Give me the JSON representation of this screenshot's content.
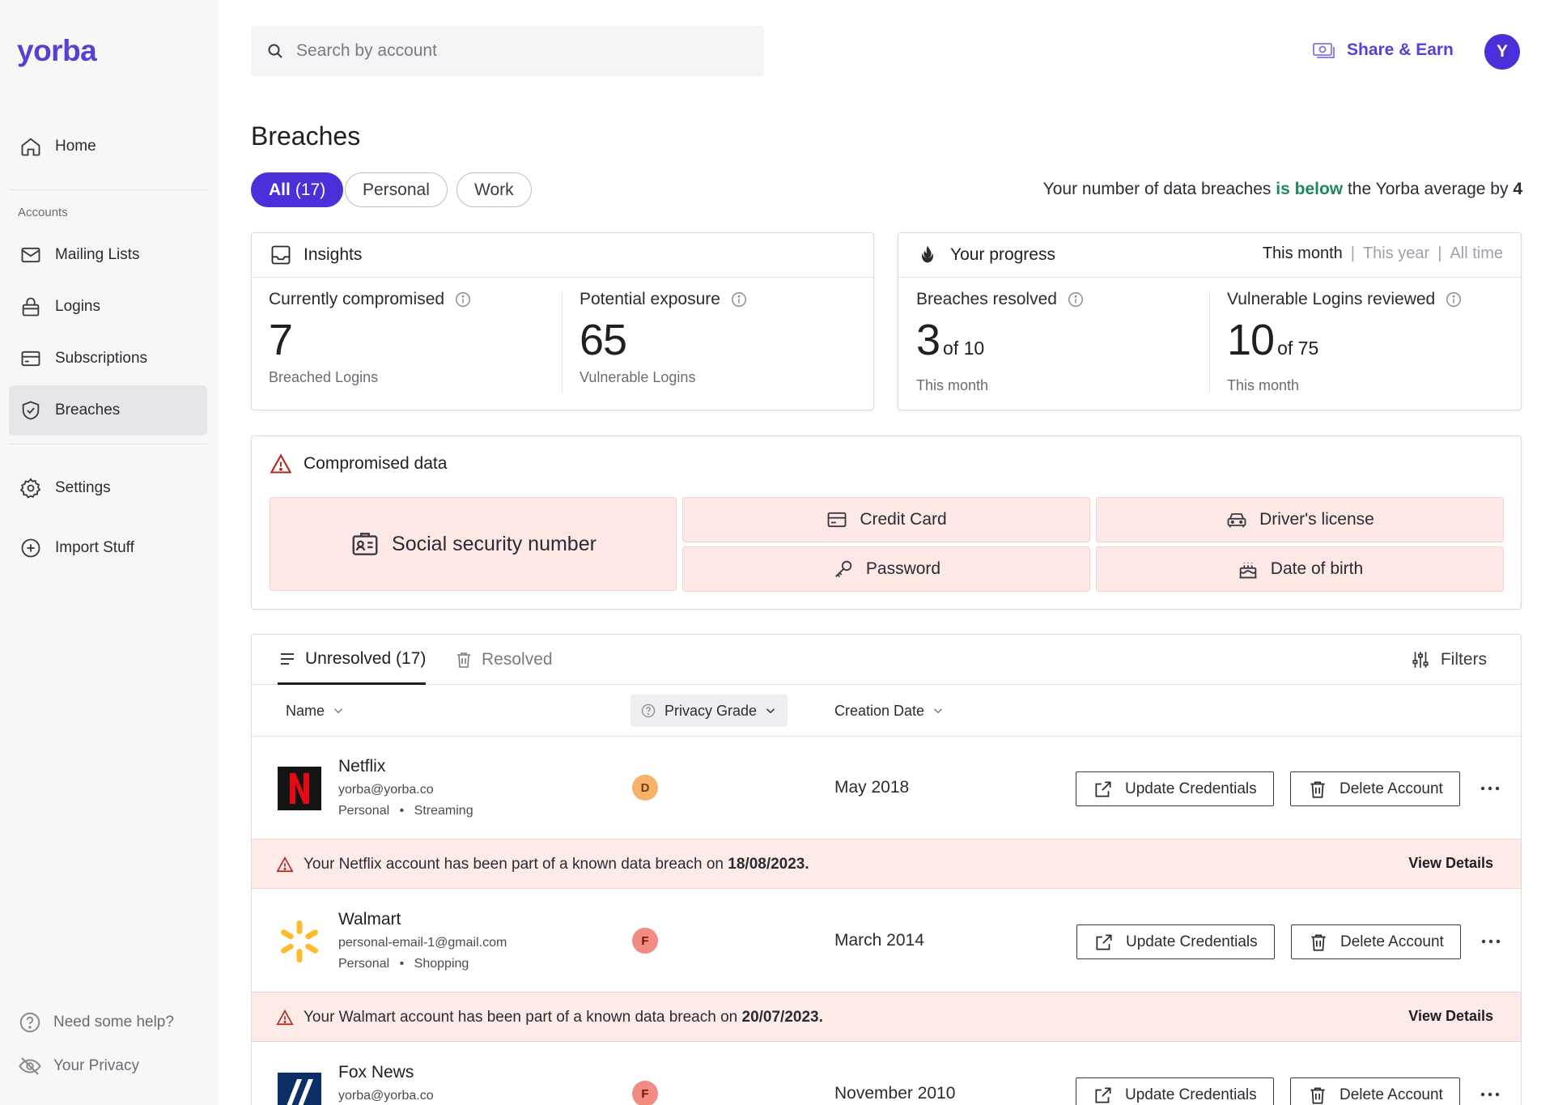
{
  "app": {
    "logo": "yorba"
  },
  "sidebar": {
    "home": "Home",
    "section_label": "Accounts",
    "items": [
      {
        "label": "Mailing Lists",
        "icon": "mail-icon"
      },
      {
        "label": "Logins",
        "icon": "lock-icon"
      },
      {
        "label": "Subscriptions",
        "icon": "card-icon"
      },
      {
        "label": "Breaches",
        "icon": "shield-icon",
        "active": true
      }
    ],
    "settings": "Settings",
    "import": "Import Stuff",
    "help": "Need some help?",
    "privacy": "Your Privacy"
  },
  "topbar": {
    "search_placeholder": "Search by account",
    "share_label": "Share & Earn",
    "avatar_initial": "Y"
  },
  "page": {
    "title": "Breaches",
    "filters": [
      {
        "label": "All",
        "count": "(17)",
        "active": true
      },
      {
        "label": "Personal"
      },
      {
        "label": "Work"
      }
    ],
    "avg_note": {
      "prefix": "Your number of data breaches",
      "highlight": "is below",
      "middle": "the Yorba average by",
      "value": "4"
    }
  },
  "insights": {
    "title": "Insights",
    "compromised": {
      "label": "Currently compromised",
      "value": "7",
      "sub": "Breached Logins"
    },
    "exposure": {
      "label": "Potential exposure",
      "value": "65",
      "sub": "Vulnerable Logins"
    }
  },
  "progress": {
    "title": "Your progress",
    "ranges": [
      "This month",
      "This year",
      "All time"
    ],
    "active_range": "This month",
    "resolved": {
      "label": "Breaches resolved",
      "value": "3",
      "of": "of 10",
      "sub": "This month"
    },
    "reviewed": {
      "label": "Vulnerable Logins reviewed",
      "value": "10",
      "of": "of 75",
      "sub": "This month"
    }
  },
  "compromised_data": {
    "title": "Compromised data",
    "ssn": "Social security number",
    "credit_card": "Credit Card",
    "drivers_license": "Driver's license",
    "password": "Password",
    "dob": "Date of birth"
  },
  "table": {
    "tab_unresolved": "Unresolved (17)",
    "tab_resolved": "Resolved",
    "filters_label": "Filters",
    "col_name": "Name",
    "col_grade": "Privacy Grade",
    "col_date": "Creation Date",
    "update_label": "Update Credentials",
    "delete_label": "Delete Account",
    "view_details": "View Details",
    "alert_prefix": "Your",
    "alert_suffix": "account has been part of a known data breach on",
    "rows": [
      {
        "name": "Netflix",
        "email": "yorba@yorba.co",
        "type": "Personal",
        "category": "Streaming",
        "grade": "D",
        "grade_color": "#f6b26b",
        "date": "May 2018",
        "breach_date": "18/08/2023."
      },
      {
        "name": "Walmart",
        "email": "personal-email-1@gmail.com",
        "type": "Personal",
        "category": "Shopping",
        "grade": "F",
        "grade_color": "#f28b82",
        "date": "March 2014",
        "breach_date": "20/07/2023."
      },
      {
        "name": "Fox News",
        "email": "yorba@yorba.co",
        "grade": "F",
        "grade_color": "#f28b82",
        "date": "November 2010"
      }
    ]
  }
}
